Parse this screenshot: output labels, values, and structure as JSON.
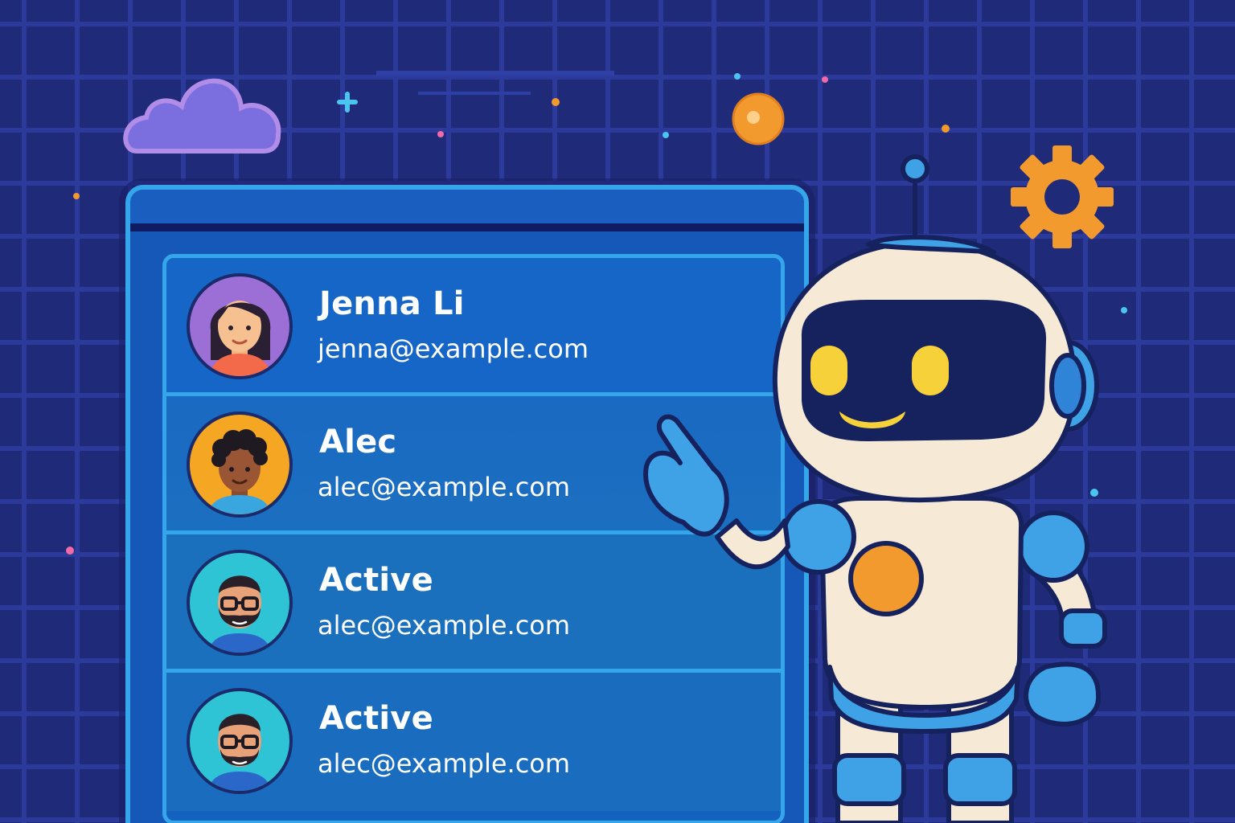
{
  "users": [
    {
      "name": "Jenna Li",
      "email": "jenna@example.com",
      "avatar_icon": "woman-avatar-icon"
    },
    {
      "name": "Alec",
      "email": "alec@example.com",
      "avatar_icon": "man-curly-hair-avatar-icon"
    },
    {
      "name": "Active",
      "email": "alec@example.com",
      "avatar_icon": "man-glasses-beard-avatar-icon"
    },
    {
      "name": "Active",
      "email": "alec@example.com",
      "avatar_icon": "man-glasses-beard-avatar-icon"
    }
  ],
  "decorations": {
    "cloud_icon": "cloud-icon",
    "gear_icon": "gear-icon",
    "robot_icon": "robot-mascot-icon",
    "sparkle_icon": "plus-sparkle-icon"
  },
  "colors": {
    "background": "#1f2a78",
    "grid": "#2c3a9c",
    "panel": "#1658b8",
    "panel_border": "#36a6ea",
    "accent_orange": "#f39a2e",
    "cloud": "#7b6fe0",
    "robot_face": "#f6d13a"
  }
}
